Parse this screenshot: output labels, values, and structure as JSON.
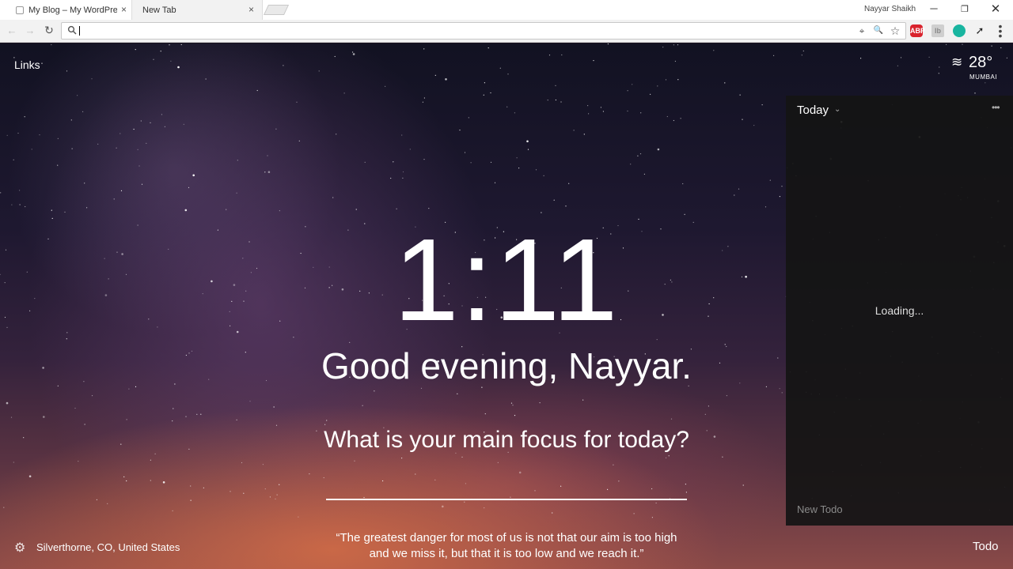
{
  "browser": {
    "tabs": [
      {
        "title": "My Blog – My WordPress",
        "close": "×",
        "active": false
      },
      {
        "title": "New Tab",
        "close": "×",
        "active": true
      }
    ],
    "profile_name": "Nayyar Shaikh",
    "window_controls": {
      "minimize": "─",
      "restore": "❐",
      "close": "✕"
    },
    "nav": {
      "back": "←",
      "forward": "→",
      "reload": "↻"
    },
    "omnibox": {
      "value": "",
      "placeholder": ""
    },
    "extensions": [
      {
        "name": "location-icon",
        "label": "⌖"
      },
      {
        "name": "zoom-icon",
        "label": "🔍"
      },
      {
        "name": "bookmark-star-icon",
        "label": "☆"
      },
      {
        "name": "adblock-plus-icon",
        "label": "ABP"
      },
      {
        "name": "extension-gray-icon",
        "label": "lb"
      },
      {
        "name": "extension-green-icon",
        "label": ""
      },
      {
        "name": "extension-arrow-icon",
        "label": "➚"
      }
    ],
    "menu_icon": "⋮"
  },
  "momentum": {
    "links_label": "Links",
    "weather": {
      "icon": "haze-icon",
      "icon_glyph": "≋",
      "temperature": "28°",
      "city": "MUMBAI"
    },
    "clock": "1:11",
    "greeting": "Good evening, Nayyar.",
    "focus_question": "What is your main focus for today?",
    "focus_input": {
      "value": "",
      "placeholder": ""
    },
    "quote_line_1": "“The greatest danger for most of us is not that our aim is too high",
    "quote_line_2": "and we miss it, but that it is too low and we reach it.”",
    "settings_icon": "⚙",
    "location": "Silverthorne, CO, United States",
    "todo_button": "Todo"
  },
  "todo_panel": {
    "header": "Today",
    "chevron": "⌄",
    "more": "•••",
    "loading": "Loading...",
    "new_todo": "New Todo"
  },
  "colors": {
    "sky_top": "#121222",
    "sky_bottom": "#8a4a48",
    "glow": "#d66e46",
    "panel_bg": "#141414",
    "abp_red": "#d9232d",
    "ext_green": "#19b5a0"
  }
}
